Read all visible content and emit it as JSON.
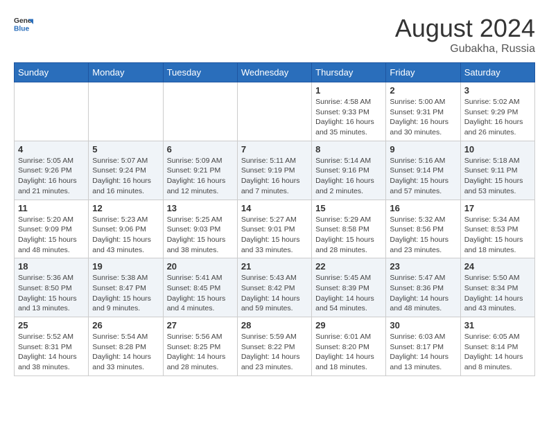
{
  "header": {
    "logo_general": "General",
    "logo_blue": "Blue",
    "month_year": "August 2024",
    "location": "Gubakha, Russia"
  },
  "days_of_week": [
    "Sunday",
    "Monday",
    "Tuesday",
    "Wednesday",
    "Thursday",
    "Friday",
    "Saturday"
  ],
  "weeks": [
    [
      {
        "day": "",
        "info": ""
      },
      {
        "day": "",
        "info": ""
      },
      {
        "day": "",
        "info": ""
      },
      {
        "day": "",
        "info": ""
      },
      {
        "day": "1",
        "info": "Sunrise: 4:58 AM\nSunset: 9:33 PM\nDaylight: 16 hours\nand 35 minutes."
      },
      {
        "day": "2",
        "info": "Sunrise: 5:00 AM\nSunset: 9:31 PM\nDaylight: 16 hours\nand 30 minutes."
      },
      {
        "day": "3",
        "info": "Sunrise: 5:02 AM\nSunset: 9:29 PM\nDaylight: 16 hours\nand 26 minutes."
      }
    ],
    [
      {
        "day": "4",
        "info": "Sunrise: 5:05 AM\nSunset: 9:26 PM\nDaylight: 16 hours\nand 21 minutes."
      },
      {
        "day": "5",
        "info": "Sunrise: 5:07 AM\nSunset: 9:24 PM\nDaylight: 16 hours\nand 16 minutes."
      },
      {
        "day": "6",
        "info": "Sunrise: 5:09 AM\nSunset: 9:21 PM\nDaylight: 16 hours\nand 12 minutes."
      },
      {
        "day": "7",
        "info": "Sunrise: 5:11 AM\nSunset: 9:19 PM\nDaylight: 16 hours\nand 7 minutes."
      },
      {
        "day": "8",
        "info": "Sunrise: 5:14 AM\nSunset: 9:16 PM\nDaylight: 16 hours\nand 2 minutes."
      },
      {
        "day": "9",
        "info": "Sunrise: 5:16 AM\nSunset: 9:14 PM\nDaylight: 15 hours\nand 57 minutes."
      },
      {
        "day": "10",
        "info": "Sunrise: 5:18 AM\nSunset: 9:11 PM\nDaylight: 15 hours\nand 53 minutes."
      }
    ],
    [
      {
        "day": "11",
        "info": "Sunrise: 5:20 AM\nSunset: 9:09 PM\nDaylight: 15 hours\nand 48 minutes."
      },
      {
        "day": "12",
        "info": "Sunrise: 5:23 AM\nSunset: 9:06 PM\nDaylight: 15 hours\nand 43 minutes."
      },
      {
        "day": "13",
        "info": "Sunrise: 5:25 AM\nSunset: 9:03 PM\nDaylight: 15 hours\nand 38 minutes."
      },
      {
        "day": "14",
        "info": "Sunrise: 5:27 AM\nSunset: 9:01 PM\nDaylight: 15 hours\nand 33 minutes."
      },
      {
        "day": "15",
        "info": "Sunrise: 5:29 AM\nSunset: 8:58 PM\nDaylight: 15 hours\nand 28 minutes."
      },
      {
        "day": "16",
        "info": "Sunrise: 5:32 AM\nSunset: 8:56 PM\nDaylight: 15 hours\nand 23 minutes."
      },
      {
        "day": "17",
        "info": "Sunrise: 5:34 AM\nSunset: 8:53 PM\nDaylight: 15 hours\nand 18 minutes."
      }
    ],
    [
      {
        "day": "18",
        "info": "Sunrise: 5:36 AM\nSunset: 8:50 PM\nDaylight: 15 hours\nand 13 minutes."
      },
      {
        "day": "19",
        "info": "Sunrise: 5:38 AM\nSunset: 8:47 PM\nDaylight: 15 hours\nand 9 minutes."
      },
      {
        "day": "20",
        "info": "Sunrise: 5:41 AM\nSunset: 8:45 PM\nDaylight: 15 hours\nand 4 minutes."
      },
      {
        "day": "21",
        "info": "Sunrise: 5:43 AM\nSunset: 8:42 PM\nDaylight: 14 hours\nand 59 minutes."
      },
      {
        "day": "22",
        "info": "Sunrise: 5:45 AM\nSunset: 8:39 PM\nDaylight: 14 hours\nand 54 minutes."
      },
      {
        "day": "23",
        "info": "Sunrise: 5:47 AM\nSunset: 8:36 PM\nDaylight: 14 hours\nand 48 minutes."
      },
      {
        "day": "24",
        "info": "Sunrise: 5:50 AM\nSunset: 8:34 PM\nDaylight: 14 hours\nand 43 minutes."
      }
    ],
    [
      {
        "day": "25",
        "info": "Sunrise: 5:52 AM\nSunset: 8:31 PM\nDaylight: 14 hours\nand 38 minutes."
      },
      {
        "day": "26",
        "info": "Sunrise: 5:54 AM\nSunset: 8:28 PM\nDaylight: 14 hours\nand 33 minutes."
      },
      {
        "day": "27",
        "info": "Sunrise: 5:56 AM\nSunset: 8:25 PM\nDaylight: 14 hours\nand 28 minutes."
      },
      {
        "day": "28",
        "info": "Sunrise: 5:59 AM\nSunset: 8:22 PM\nDaylight: 14 hours\nand 23 minutes."
      },
      {
        "day": "29",
        "info": "Sunrise: 6:01 AM\nSunset: 8:20 PM\nDaylight: 14 hours\nand 18 minutes."
      },
      {
        "day": "30",
        "info": "Sunrise: 6:03 AM\nSunset: 8:17 PM\nDaylight: 14 hours\nand 13 minutes."
      },
      {
        "day": "31",
        "info": "Sunrise: 6:05 AM\nSunset: 8:14 PM\nDaylight: 14 hours\nand 8 minutes."
      }
    ]
  ]
}
